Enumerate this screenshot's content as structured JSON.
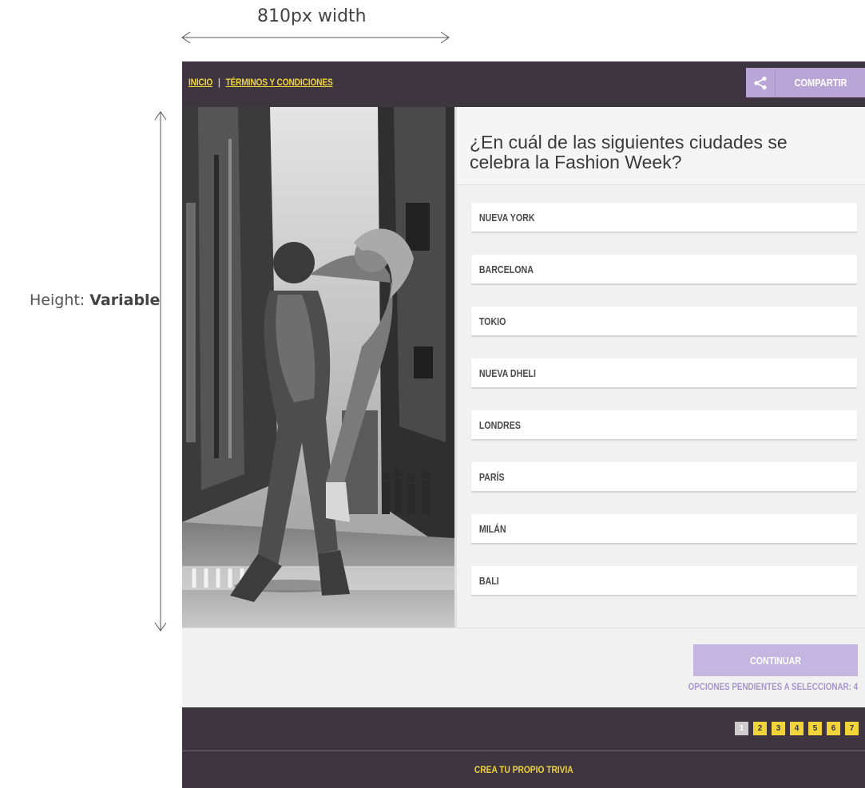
{
  "annotations": {
    "width_label": "810px width",
    "height_prefix": "Height: ",
    "height_value": "Variable"
  },
  "nav": {
    "home": "INICIO",
    "separator": "|",
    "terms": "TÉRMINOS Y CONDICIONES"
  },
  "share": {
    "label": "COMPARTIR",
    "icon": "share-icon"
  },
  "photo": {
    "icon": "photo-couple-street"
  },
  "question": "¿En cuál de las siguientes ciudades se celebra la Fashion Week?",
  "options": [
    "NUEVA YORK",
    "BARCELONA",
    "TOKIO",
    "NUEVA DHELI",
    "LONDRES",
    "PARÍS",
    "MILÁN",
    "BALI"
  ],
  "continue_label": "CONTINUAR",
  "pending_text": "OPCIONES PENDIENTES A SELECCIONAR: 4",
  "pagination": {
    "pages": [
      "1",
      "2",
      "3",
      "4",
      "5",
      "6",
      "7"
    ],
    "active": "1"
  },
  "footer": {
    "label": "CREA TU PROPIO TRIVIA"
  },
  "colors": {
    "bar": "#3e3541",
    "accent_yellow": "#f0d43a",
    "accent_lavender": "#b9a6d6"
  }
}
